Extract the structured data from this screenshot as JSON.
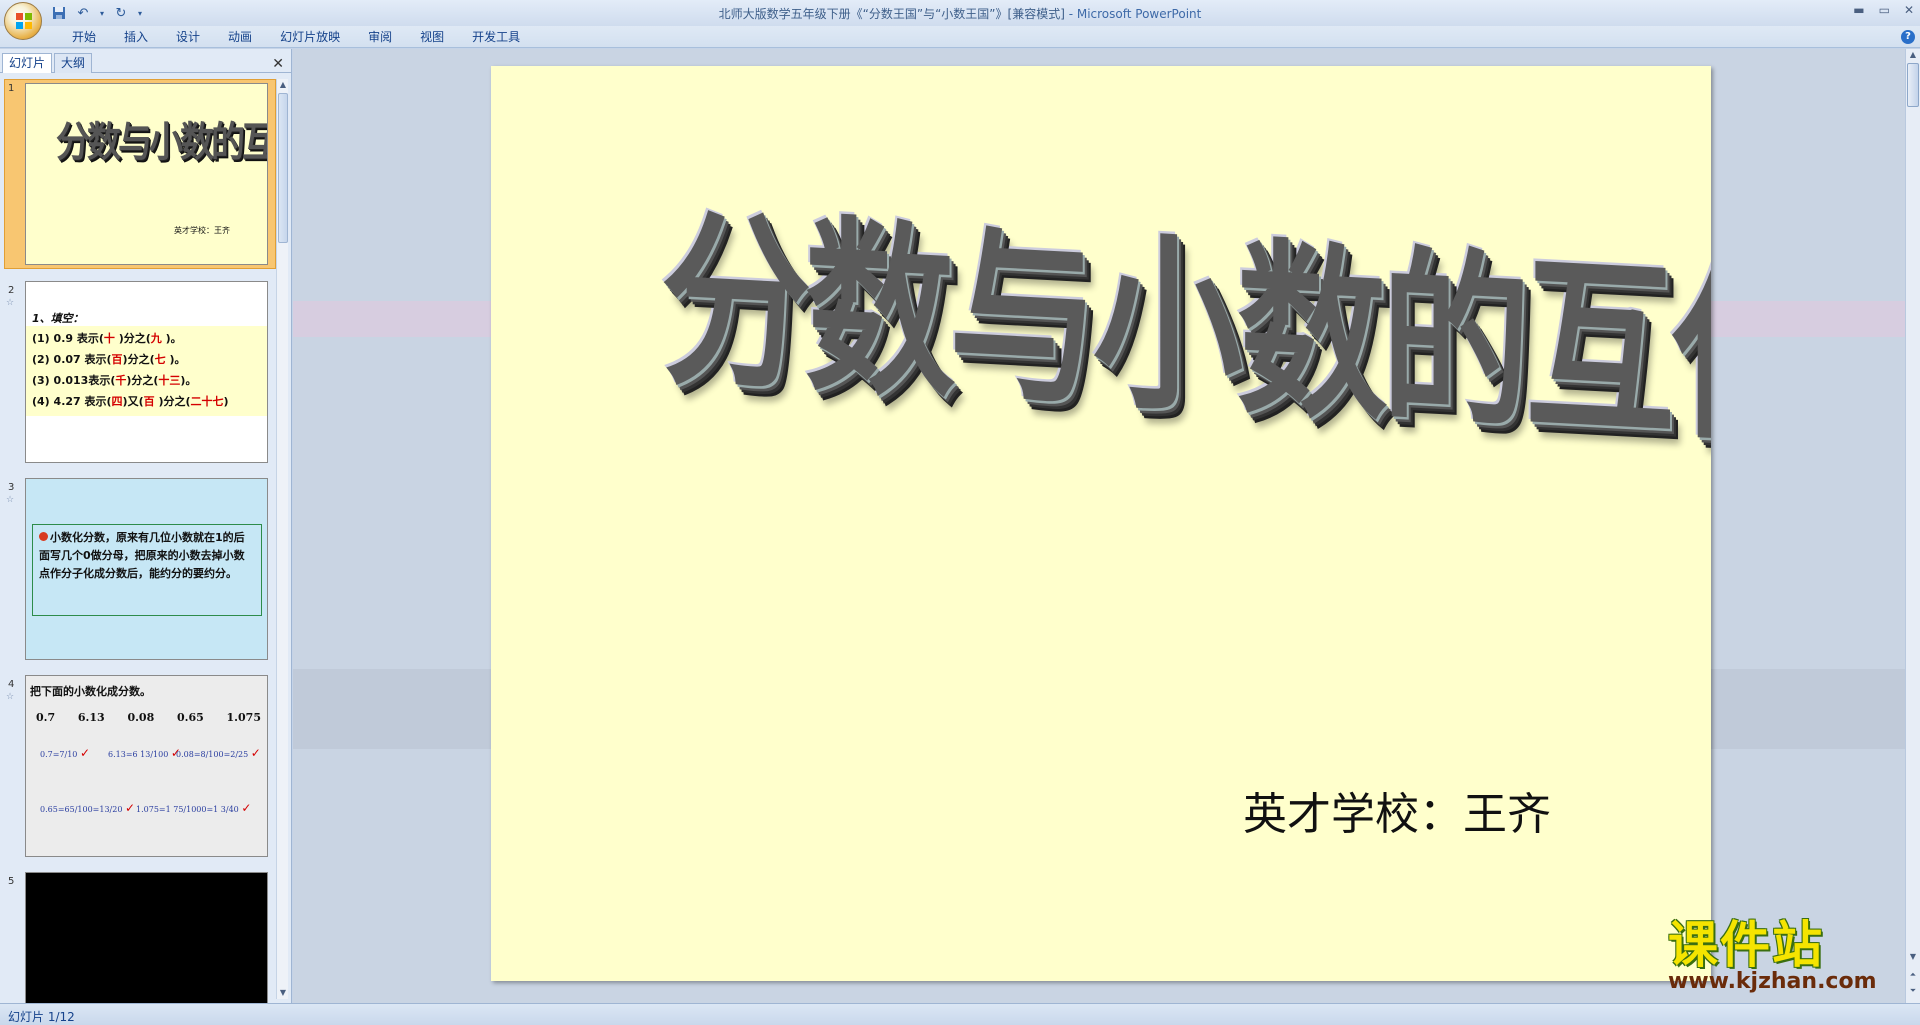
{
  "window": {
    "title": "北师大版数学五年级下册《“分数王国”与“小数王国”》[兼容模式]",
    "app_name": " - Microsoft PowerPoint"
  },
  "ribbon": {
    "tabs": [
      "开始",
      "插入",
      "设计",
      "动画",
      "幻灯片放映",
      "审阅",
      "视图",
      "开发工具"
    ]
  },
  "left_pane": {
    "tabs": [
      "幻灯片",
      "大纲"
    ]
  },
  "thumbnails": [
    {
      "num": "1",
      "title": "分数与小数的互化",
      "subtitle": "英才学校：王齐"
    },
    {
      "num": "2",
      "heading": "1、填空：",
      "lines": [
        [
          "(1) 0.9  表示(",
          "十",
          " )分之(",
          "九",
          " )。"
        ],
        [
          "(2) 0.07 表示(",
          "百",
          ")分之(",
          "七",
          " )。"
        ],
        [
          "(3) 0.013表示(",
          "千",
          ")分之(",
          "十三",
          ")。"
        ],
        [
          "(4) 4.27 表示(",
          "四",
          ")又(",
          "百",
          " )分之(",
          "二十七",
          ")"
        ]
      ]
    },
    {
      "num": "3",
      "text": "小数化分数，原来有几位小数就在1的后面写几个0做分母，把原来的小数去掉小数点作分子化成分数后，能约分的要约分。"
    },
    {
      "num": "4",
      "heading": "把下面的小数化成分数。",
      "numbers": [
        "0.7",
        "6.13",
        "0.08",
        "0.65",
        "1.075"
      ],
      "work": [
        "0.7=7/10",
        "6.13=6 13/100",
        "0.08=8/100=2/25",
        "0.65=65/100=13/20",
        "1.075=1 75/1000=1 3/40"
      ]
    },
    {
      "num": "5"
    }
  ],
  "slide": {
    "title": "分数与小数的互化",
    "subtitle": "英才学校：王齐"
  },
  "status": {
    "text": "幻灯片 1/12"
  },
  "watermark": {
    "text": "课件站",
    "url": "www.kjzhan.com"
  },
  "colors": {
    "slide_bg": "#ffffcc",
    "selected_thumb": "#f8c671",
    "ribbon_text": "#15428b"
  }
}
